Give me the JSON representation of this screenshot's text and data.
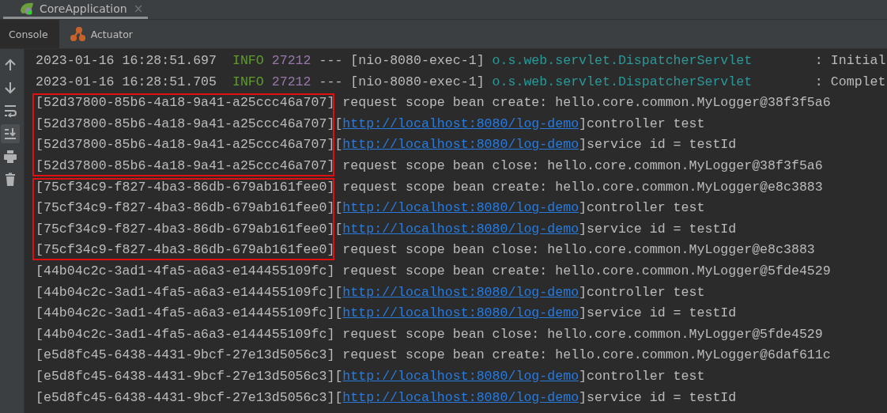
{
  "run_tab": {
    "title": "CoreApplication",
    "close": "×"
  },
  "tabs": [
    {
      "label": "Console",
      "selected": true,
      "kind": "console"
    },
    {
      "label": "Actuator",
      "selected": false,
      "kind": "actuator"
    }
  ],
  "toolbar": [
    {
      "kind": "up",
      "selected": false
    },
    {
      "kind": "down",
      "selected": false
    },
    {
      "kind": "wrap",
      "selected": false
    },
    {
      "kind": "scroll-end",
      "selected": true
    },
    {
      "kind": "print",
      "selected": false
    },
    {
      "kind": "trash",
      "selected": false
    }
  ],
  "groups": [
    {
      "highlighted": false,
      "lines": [
        [
          {
            "kind": "plain",
            "text": "2023-01-16 16:28:51.697  "
          },
          {
            "kind": "level",
            "text": "INFO"
          },
          {
            "kind": "pid",
            "text": "27212"
          },
          {
            "kind": "plain",
            "text": " --- [nio-8080-exec-1] "
          },
          {
            "kind": "logger",
            "text": "o.s.web.servlet.DispatcherServlet"
          },
          {
            "kind": "plain",
            "text": "        : Initial"
          }
        ],
        [
          {
            "kind": "plain",
            "text": "2023-01-16 16:28:51.705  "
          },
          {
            "kind": "level",
            "text": "INFO"
          },
          {
            "kind": "pid",
            "text": "27212"
          },
          {
            "kind": "plain",
            "text": " --- [nio-8080-exec-1] "
          },
          {
            "kind": "logger",
            "text": "o.s.web.servlet.DispatcherServlet"
          },
          {
            "kind": "plain",
            "text": "        : Complet"
          }
        ]
      ]
    },
    {
      "highlighted": true,
      "lines": [
        [
          {
            "kind": "plain",
            "text": "[52d37800-85b6-4a18-9a41-a25ccc46a707] request scope bean create: hello.core.common.MyLogger@38f3f5a6"
          }
        ],
        [
          {
            "kind": "plain",
            "text": "[52d37800-85b6-4a18-9a41-a25ccc46a707]["
          },
          {
            "kind": "link",
            "text": "http://localhost:8080/log-demo"
          },
          {
            "kind": "plain",
            "text": "]controller test"
          }
        ],
        [
          {
            "kind": "plain",
            "text": "[52d37800-85b6-4a18-9a41-a25ccc46a707]["
          },
          {
            "kind": "link",
            "text": "http://localhost:8080/log-demo"
          },
          {
            "kind": "plain",
            "text": "]service id = testId"
          }
        ],
        [
          {
            "kind": "plain",
            "text": "[52d37800-85b6-4a18-9a41-a25ccc46a707] request scope bean close: hello.core.common.MyLogger@38f3f5a6"
          }
        ]
      ]
    },
    {
      "highlighted": true,
      "lines": [
        [
          {
            "kind": "plain",
            "text": "[75cf34c9-f827-4ba3-86db-679ab161fee0] request scope bean create: hello.core.common.MyLogger@e8c3883"
          }
        ],
        [
          {
            "kind": "plain",
            "text": "[75cf34c9-f827-4ba3-86db-679ab161fee0]["
          },
          {
            "kind": "link",
            "text": "http://localhost:8080/log-demo"
          },
          {
            "kind": "plain",
            "text": "]controller test"
          }
        ],
        [
          {
            "kind": "plain",
            "text": "[75cf34c9-f827-4ba3-86db-679ab161fee0]["
          },
          {
            "kind": "link",
            "text": "http://localhost:8080/log-demo"
          },
          {
            "kind": "plain",
            "text": "]service id = testId"
          }
        ],
        [
          {
            "kind": "plain",
            "text": "[75cf34c9-f827-4ba3-86db-679ab161fee0] request scope bean close: hello.core.common.MyLogger@e8c3883"
          }
        ]
      ]
    },
    {
      "highlighted": false,
      "lines": [
        [
          {
            "kind": "plain",
            "text": "[44b04c2c-3ad1-4fa5-a6a3-e144455109fc] request scope bean create: hello.core.common.MyLogger@5fde4529"
          }
        ],
        [
          {
            "kind": "plain",
            "text": "[44b04c2c-3ad1-4fa5-a6a3-e144455109fc]["
          },
          {
            "kind": "link",
            "text": "http://localhost:8080/log-demo"
          },
          {
            "kind": "plain",
            "text": "]controller test"
          }
        ],
        [
          {
            "kind": "plain",
            "text": "[44b04c2c-3ad1-4fa5-a6a3-e144455109fc]["
          },
          {
            "kind": "link",
            "text": "http://localhost:8080/log-demo"
          },
          {
            "kind": "plain",
            "text": "]service id = testId"
          }
        ],
        [
          {
            "kind": "plain",
            "text": "[44b04c2c-3ad1-4fa5-a6a3-e144455109fc] request scope bean close: hello.core.common.MyLogger@5fde4529"
          }
        ],
        [
          {
            "kind": "plain",
            "text": "[e5d8fc45-6438-4431-9bcf-27e13d5056c3] request scope bean create: hello.core.common.MyLogger@6daf611c"
          }
        ],
        [
          {
            "kind": "plain",
            "text": "[e5d8fc45-6438-4431-9bcf-27e13d5056c3]["
          },
          {
            "kind": "link",
            "text": "http://localhost:8080/log-demo"
          },
          {
            "kind": "plain",
            "text": "]controller test"
          }
        ],
        [
          {
            "kind": "plain",
            "text": "[e5d8fc45-6438-4431-9bcf-27e13d5056c3]["
          },
          {
            "kind": "link",
            "text": "http://localhost:8080/log-demo"
          },
          {
            "kind": "plain",
            "text": "]service id = testId"
          }
        ]
      ]
    }
  ]
}
